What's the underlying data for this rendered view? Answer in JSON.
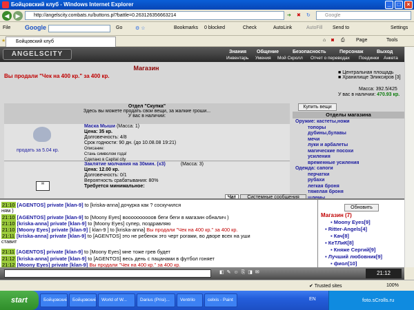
{
  "window": {
    "title": "Бойцовский клуб - Windows Internet Explorer"
  },
  "address": {
    "url": "http://angelscity.combats.ru/buttons.pl?battle=0.263126356663214",
    "search_placeholder": "Google"
  },
  "gbar": {
    "file": "File",
    "google": "Google",
    "go": "Go",
    "bookmarks": "Bookmarks",
    "blocked": "0 blocked",
    "check": "Check",
    "autolink": "AutoLink",
    "autofill": "AutoFill",
    "send": "Send to",
    "settings": "Settings"
  },
  "tabs": {
    "tab1": "Бойцовский клуб",
    "page": "Page",
    "tools": "Tools"
  },
  "site": {
    "logo": "ANGELSCITY",
    "menu_top": [
      "Знания",
      "Общение",
      "Безопасность",
      "Персонаж",
      "Выход"
    ],
    "menu_sub": [
      "Инвентарь",
      "Умения",
      "Мой Скролл",
      "Отчет о переводах",
      "Поединки",
      "Анкета"
    ],
    "shop_title": "Магазин",
    "sold_msg": "Вы продали \"Чек на 400 кр.\" за 400 кр.",
    "locations": [
      "Центральная площадь",
      "Хранилище Эликсиров [3]"
    ],
    "weight": "Масса: 392.5/425",
    "money_label": "У вас в наличии:",
    "money_value": "470.93 кр.",
    "buy_btn": "Купить вещи",
    "dept_title": "Отдел \"Скупка\"",
    "dept_sub": "Здесь вы можете продать свои вещи, за жалкие гроши...",
    "dept_have": "У вас в наличии:",
    "item1": {
      "name": "Маска Мыши",
      "mass": "(Масса: 1)",
      "price": "Цена: 35 кр.",
      "dur": "Долговечность: 4/8",
      "term": "Срок годности: 90 дн. (до 10.08.08 19:21)",
      "desc": "Описание:",
      "desc2": "Стань символом года!",
      "made": "Сделано в Capital city",
      "sell": "продать за 5.04 кр."
    },
    "item2": {
      "name": "Заклятие молчания на 30мин. (x3)",
      "mass": "(Масса: 3)",
      "price": "Цена: 12.00 кр.",
      "dur": "Долговечность: 0/1",
      "prob": "Вероятность срабатывания: 80%",
      "req": "Требуется минимальное:"
    },
    "sections_title": "Отделы магазина",
    "sections": [
      {
        "label": "Оружие: кастеты,ножи",
        "bold": true
      },
      {
        "label": "топоры",
        "bold": false
      },
      {
        "label": "дубины,булавы",
        "bold": false
      },
      {
        "label": "мечи",
        "bold": false
      },
      {
        "label": "луки и арбалеты",
        "bold": false
      },
      {
        "label": "магические посохи",
        "bold": false
      },
      {
        "label": "усиления",
        "bold": false
      },
      {
        "label": "временные усиления",
        "bold": false
      },
      {
        "label": "Одежда: сапоги",
        "bold": true
      },
      {
        "label": "перчатки",
        "bold": false
      },
      {
        "label": "рубахи",
        "bold": false
      },
      {
        "label": "легкая броня",
        "bold": false
      },
      {
        "label": "тяжелая броня",
        "bold": false
      },
      {
        "label": "шлемы",
        "bold": false
      }
    ]
  },
  "chat": {
    "tab_chat": "Чат",
    "tab_sys": "Системные сообщения",
    "lines": [
      {
        "t": "21:10",
        "n": "[AGENTOS]",
        "txt": " to [kriska-anna] дочурка как ? соскучился",
        "r": false
      },
      {
        "t": "",
        "n": "",
        "txt": "ням )",
        "r": false
      },
      {
        "t": "21:10",
        "n": "[AGENTOS]",
        "txt": " to [Moony Eyes] воооооооооов беги беги в магазин обналич )",
        "r": false
      },
      {
        "t": "21:10",
        "n": "[kriska-anna]",
        "txt": " to [Moony Eyes] супер, поздравляю",
        "r": false
      },
      {
        "t": "21:10",
        "n": "[Moony Eyes]",
        "txt": " [ klan-9 ] to [kriska-anna] ",
        "r": true
      },
      {
        "t": "21:11",
        "n": "[kriska-anna]",
        "txt": " to [AGENTOS] это не ребенок это черт рогами, во дворе всех на уши",
        "r": false
      },
      {
        "t": "",
        "n": "",
        "txt": "ставит",
        "r": false
      },
      {
        "t": "21:11",
        "n": "[AGENTOS]",
        "txt": " to [Moony Eyes] мне тоже грев будет",
        "r": false
      },
      {
        "t": "21:12",
        "n": "[kriska-anna]",
        "txt": " to [AGENTOS] весь день с пацанами в футбол гоняет",
        "r": false
      },
      {
        "t": "21:12",
        "n": "[Moony Eyes]",
        "txt": " ",
        "r": true
      }
    ],
    "private_word": "private",
    "klan": "[klan-9]",
    "sold_tail": "Вы продали \"Чек на 400 кр.\" за 400 кр."
  },
  "right": {
    "refresh": "Обновить",
    "title": "Магазин (7)",
    "users": [
      "Moony Eyes[9]",
      "Ritter-Angels[4]",
      "Кач[8]",
      "КеТЛиК[8]",
      "Княже Сергий[9]",
      "Лучший любовник[9]",
      "фиол[10]"
    ]
  },
  "status": {
    "zone": "Trusted sites",
    "zoom": "100%"
  },
  "taskbar": {
    "start": "start",
    "tasks": [
      "Бойцовский кл...",
      "Бойцовский...",
      "World of W...",
      "Darius (Prisi)...",
      "Ventrilo",
      "celxis - Paint"
    ],
    "lang": "EN",
    "clock": "21:12",
    "watermark": "foto.sCrolls.ru"
  }
}
